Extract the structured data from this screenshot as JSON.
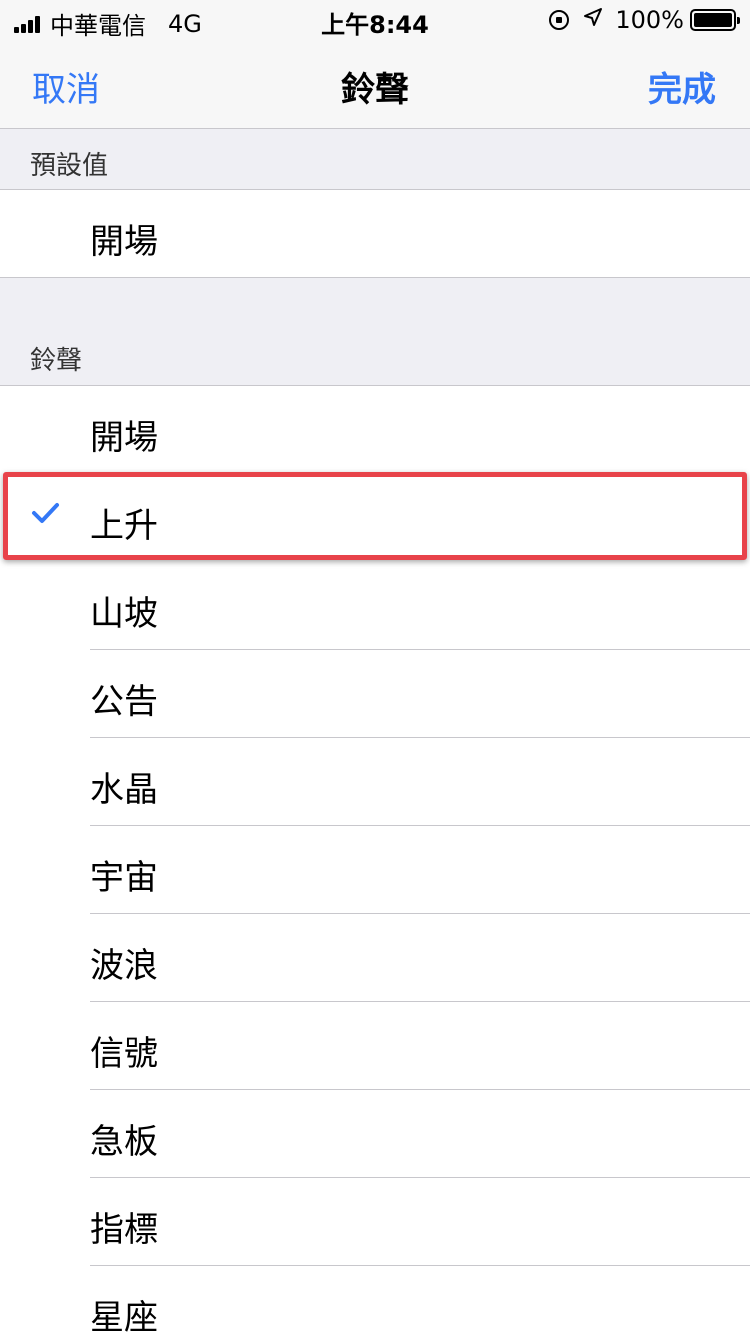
{
  "status_bar": {
    "carrier": "中華電信",
    "network": "4G",
    "time": "上午8:44",
    "battery": "100%"
  },
  "nav": {
    "cancel": "取消",
    "title": "鈴聲",
    "done": "完成"
  },
  "sections": {
    "default_header": "預設值",
    "default_items": [
      "開場"
    ],
    "ringtone_header": "鈴聲",
    "ringtone_items": [
      "開場",
      "上升",
      "山坡",
      "公告",
      "水晶",
      "宇宙",
      "波浪",
      "信號",
      "急板",
      "指標",
      "星座"
    ],
    "selected": "上升"
  },
  "colors": {
    "accent": "#3478f6",
    "highlight": "#e8434a"
  }
}
